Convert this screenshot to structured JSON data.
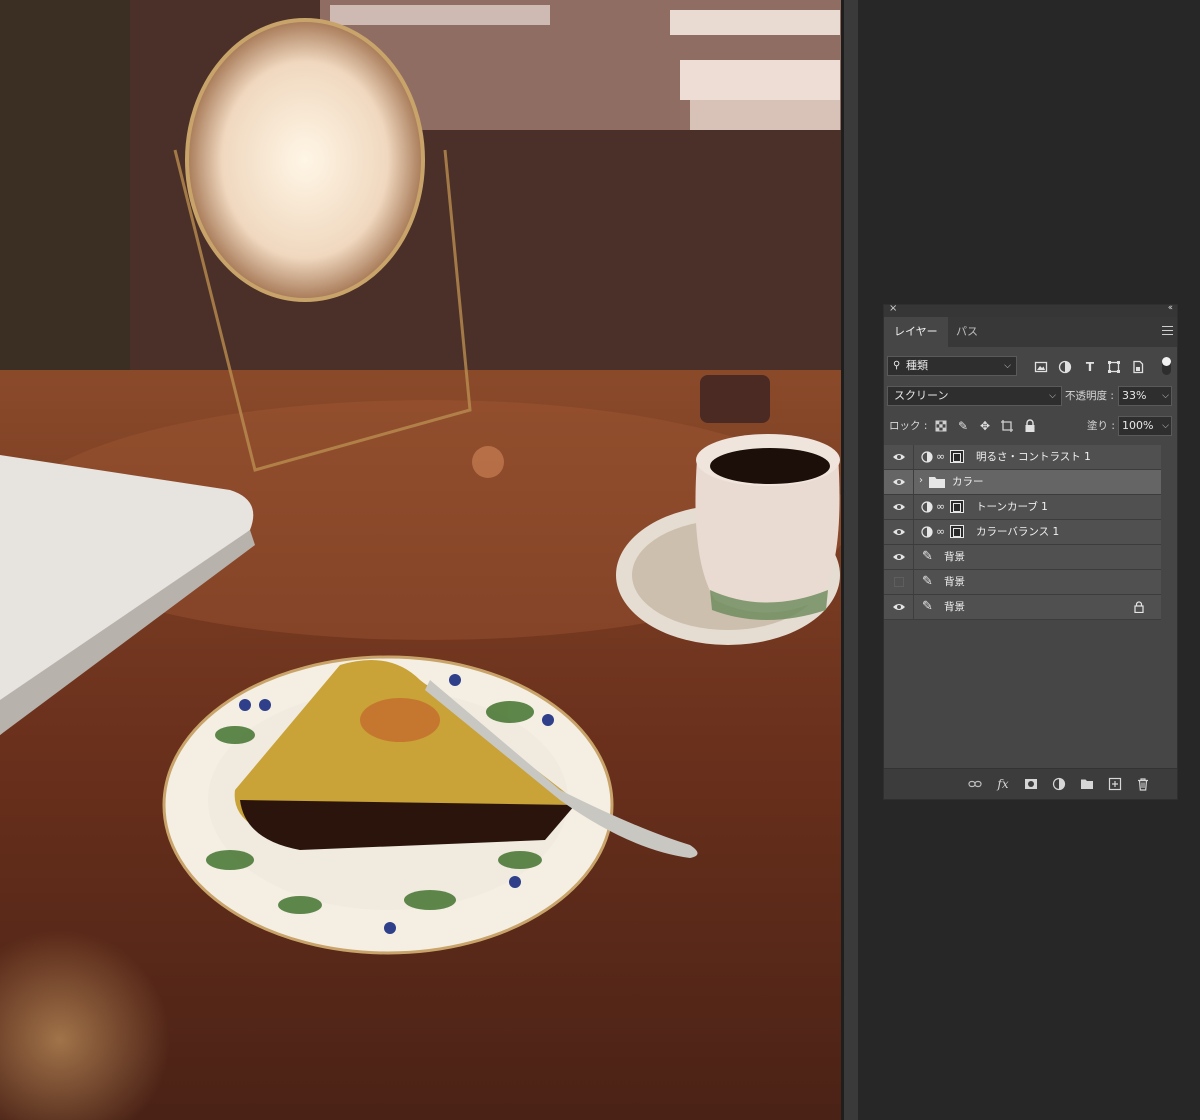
{
  "panel": {
    "close_glyph": "×",
    "collapse_glyph": "‹‹",
    "tabs": [
      {
        "label": "レイヤー",
        "active": true
      },
      {
        "label": "パス",
        "active": false
      }
    ],
    "filter": {
      "label": "種類"
    },
    "blend_mode": "スクリーン",
    "opacity_label": "不透明度 :",
    "opacity_value": "33%",
    "lock_label": "ロック :",
    "fill_label": "塗り :",
    "fill_value": "100%",
    "layers": [
      {
        "name": "明るさ・コントラスト 1",
        "visible": true,
        "type": "adjustment",
        "selected": false,
        "locked": false
      },
      {
        "name": "カラー",
        "visible": true,
        "type": "group",
        "selected": true,
        "locked": false
      },
      {
        "name": "トーンカーブ 1",
        "visible": true,
        "type": "adjustment",
        "selected": false,
        "locked": false
      },
      {
        "name": "カラーバランス 1",
        "visible": true,
        "type": "adjustment",
        "selected": false,
        "locked": false
      },
      {
        "name": "背景",
        "visible": true,
        "type": "pixel",
        "selected": false,
        "locked": false
      },
      {
        "name": "背景",
        "visible": false,
        "type": "pixel",
        "selected": false,
        "locked": false
      },
      {
        "name": "背景",
        "visible": true,
        "type": "pixel",
        "selected": false,
        "locked": true
      }
    ],
    "footer_icons": [
      "link-icon",
      "fx-icon",
      "mask-icon",
      "adjustment-icon",
      "folder-icon",
      "new-layer-icon",
      "trash-icon"
    ],
    "fx_text": "fx"
  },
  "colors": {
    "panel_bg": "#464646",
    "selected_row": "#656565",
    "app_bg": "#272727"
  }
}
